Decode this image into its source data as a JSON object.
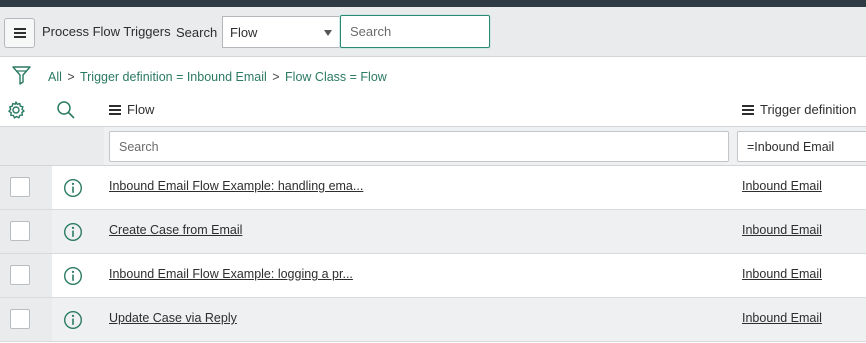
{
  "header": {
    "title": "Process Flow Triggers",
    "search_label": "Search",
    "search_field_selected": "Flow",
    "search_placeholder": "Search"
  },
  "breadcrumb": {
    "items": [
      "All",
      "Trigger definition = Inbound Email",
      "Flow Class = Flow"
    ],
    "separator": ">"
  },
  "columns": {
    "flow": "Flow",
    "trigger_definition": "Trigger definition"
  },
  "column_search": {
    "flow_placeholder": "Search",
    "trigger_value": "=Inbound Email"
  },
  "rows": [
    {
      "flow": "Inbound Email Flow Example: handling ema...",
      "trigger": "Inbound Email"
    },
    {
      "flow": "Create Case from Email",
      "trigger": "Inbound Email"
    },
    {
      "flow": "Inbound Email Flow Example: logging a pr...",
      "trigger": "Inbound Email"
    },
    {
      "flow": "Update Case via Reply",
      "trigger": "Inbound Email"
    }
  ],
  "colors": {
    "accent": "#2b7a63",
    "topbar": "#2f3b44",
    "header_bg": "#e9ebec"
  }
}
